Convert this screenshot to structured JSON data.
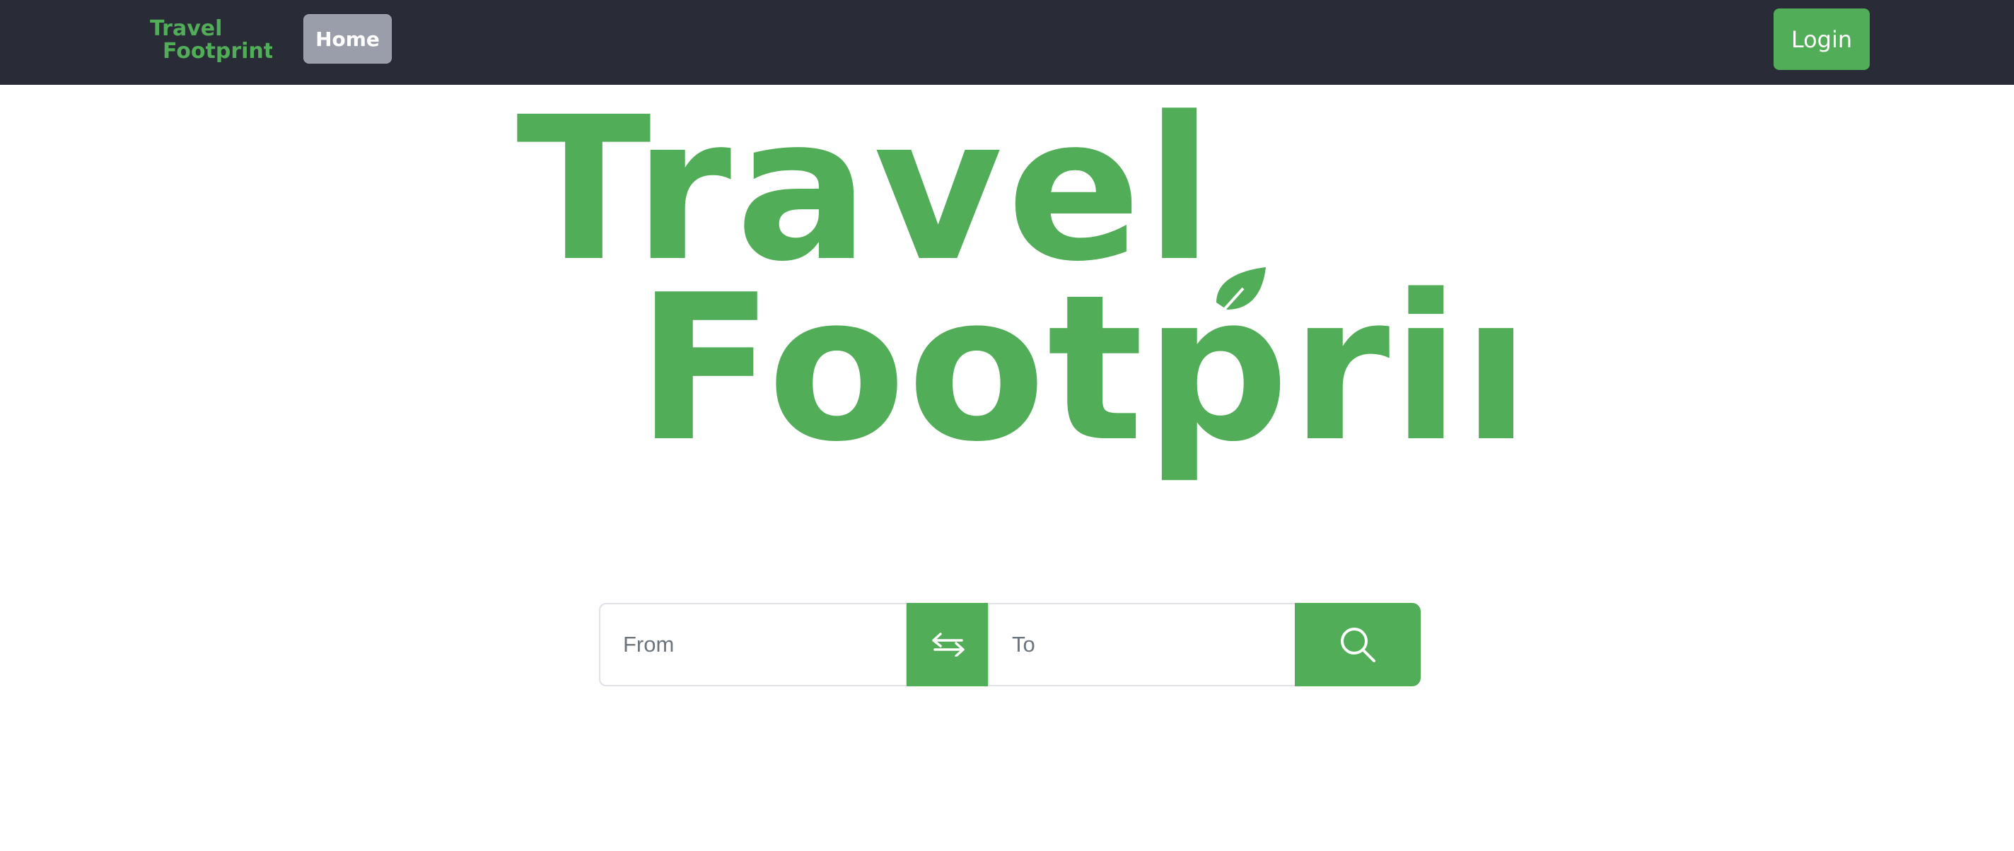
{
  "colors": {
    "navbar": "#292c36",
    "brand_green": "#51ad57",
    "home_button": "#9a9eaa"
  },
  "nav": {
    "logo_line1": "Travel",
    "logo_line2": "Footprint",
    "home_label": "Home",
    "login_label": "Login"
  },
  "hero": {
    "line1": "Travel",
    "line2": "Footprint",
    "leaf_icon": "leaf-icon"
  },
  "search": {
    "from_placeholder": "From",
    "to_placeholder": "To",
    "swap_icon": "swap-arrows-icon",
    "search_icon": "magnifier-icon"
  }
}
